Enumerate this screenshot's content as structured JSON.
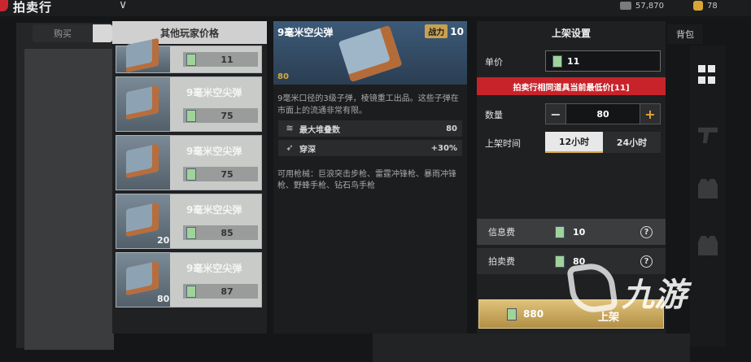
{
  "app": {
    "title": "拍卖行"
  },
  "currency": {
    "silver": "57,870",
    "gold": "78"
  },
  "tabs": {
    "buy": "购买"
  },
  "price_list": {
    "header": "其他玩家价格",
    "items": [
      {
        "name": "",
        "qty": "",
        "price": "11"
      },
      {
        "name": "9毫米空尖弹",
        "qty": "",
        "price": "75"
      },
      {
        "name": "9毫米空尖弹",
        "qty": "",
        "price": "75"
      },
      {
        "name": "9毫米空尖弹",
        "qty": "20",
        "price": "85"
      },
      {
        "name": "9毫米空尖弹",
        "qty": "80",
        "price": "87"
      }
    ]
  },
  "detail": {
    "name": "9毫米空尖弹",
    "power_label": "战力",
    "power_value": "10",
    "count": "80",
    "description": "9毫米口径的3级子弹，棱镜重工出品。这些子弹在市面上的流通非常有限。",
    "stats": [
      {
        "icon": "layers-icon",
        "label": "最大堆叠数",
        "value": "80"
      },
      {
        "icon": "penetration-icon",
        "label": "穿深",
        "value": "+30%"
      }
    ],
    "usable_guns": "可用枪械：巨浪突击步枪、雷霆冲锋枪、暴雨冲锋枪、野蜂手枪、钻石鸟手枪"
  },
  "settings": {
    "header": "上架设置",
    "unit_price_label": "单价",
    "unit_price": "11",
    "warning": "拍卖行相同道具当前最低价[11]",
    "quantity_label": "数量",
    "quantity": "80",
    "minus": "−",
    "plus": "+",
    "duration_label": "上架时间",
    "duration_options": [
      "12小时",
      "24小时"
    ],
    "duration_selected": "12小时",
    "info_fee_label": "信息费",
    "info_fee": "10",
    "auction_fee_label": "拍卖费",
    "auction_fee": "80",
    "help": "?",
    "confirm_amount": "880",
    "confirm_label": "上架"
  },
  "side": {
    "bag_tab": "背包"
  },
  "watermark": {
    "text": "九游"
  }
}
